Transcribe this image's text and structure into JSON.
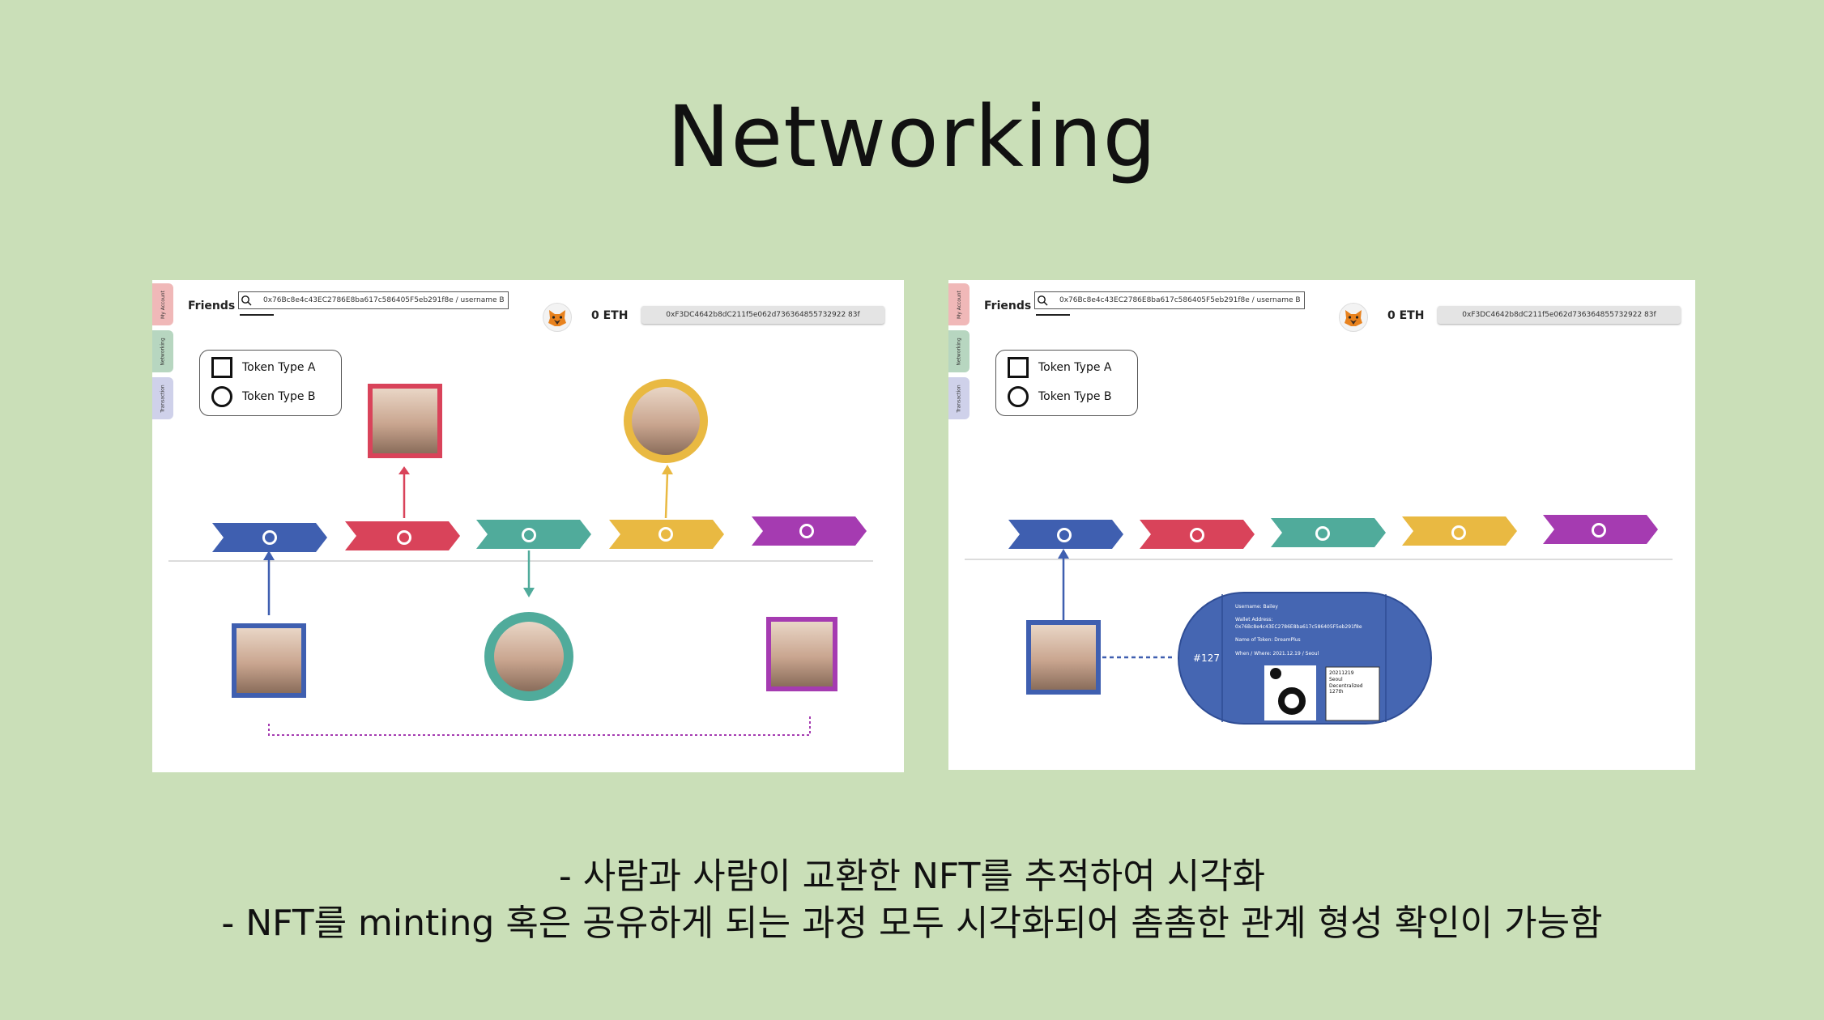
{
  "title": "Networking",
  "captions": [
    "- 사람과 사람이 교환한 NFT를 추적하여 시각화",
    "- NFT를 minting 혹은 공유하게 되는 과정 모두 시각화되어 촘촘한 관계 형성 확인이 가능함"
  ],
  "tabs": [
    "My Account",
    "Networking",
    "Transaction"
  ],
  "header": {
    "friends_label": "Friends",
    "search_value": "0x76Bc8e4c43EC2786E8ba617c586405F5eb291f8e / username B",
    "eth_balance": "0 ETH",
    "wallet_address": "0xF3DC4642b8dC211f5e062d736364855732922 83f"
  },
  "legend": {
    "type_a": "Token Type A",
    "type_b": "Token Type B"
  },
  "card": {
    "number": "#127",
    "lines": [
      "Username: Bailey",
      "Wallet Address:",
      "0x76Bc8e4c43EC2786E8ba617c586405F5eb291f8e",
      "Name of Token: DreamPlus",
      "When / Where: 2021.12.19 / Seoul"
    ],
    "sub": [
      "20211219",
      "Seoul",
      "Decentralized",
      "127th"
    ]
  },
  "colors": {
    "blue": "#3f5fb0",
    "red": "#d9435a",
    "teal": "#50ab9b",
    "yellow": "#e9b942",
    "purple": "#a53bb1",
    "background": "#cadfb8"
  },
  "icons": [
    "search-icon",
    "metamask-fox-icon"
  ]
}
